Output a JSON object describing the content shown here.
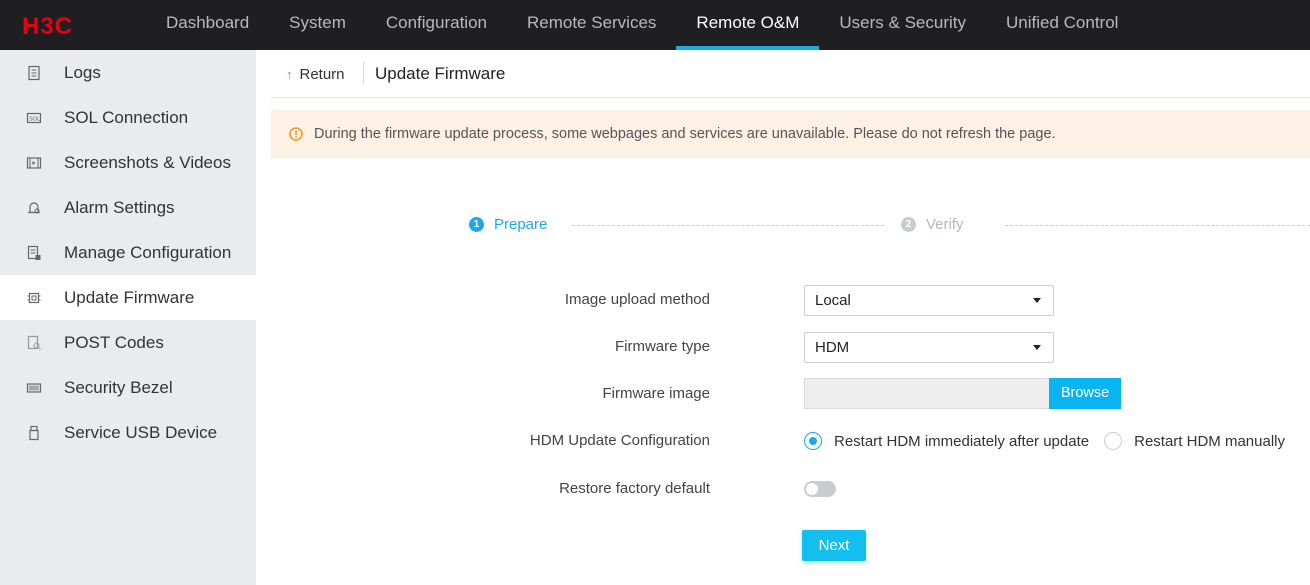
{
  "brand": {
    "logo": "H3C",
    "accent": "#1fa8e6",
    "logo_color": "#e60012"
  },
  "nav": {
    "items": [
      {
        "label": "Dashboard"
      },
      {
        "label": "System"
      },
      {
        "label": "Configuration"
      },
      {
        "label": "Remote Services"
      },
      {
        "label": "Remote O&M",
        "active": true
      },
      {
        "label": "Users & Security"
      },
      {
        "label": "Unified Control"
      }
    ]
  },
  "sidebar": {
    "items": [
      {
        "label": "Logs",
        "icon": "log-icon"
      },
      {
        "label": "SOL Connection",
        "icon": "sol-icon"
      },
      {
        "label": "Screenshots & Videos",
        "icon": "video-icon"
      },
      {
        "label": "Alarm Settings",
        "icon": "bell-icon"
      },
      {
        "label": "Manage Configuration",
        "icon": "config-icon"
      },
      {
        "label": "Update Firmware",
        "icon": "firmware-icon",
        "active": true
      },
      {
        "label": "POST Codes",
        "icon": "post-codes-icon"
      },
      {
        "label": "Security Bezel",
        "icon": "bezel-icon"
      },
      {
        "label": "Service USB Device",
        "icon": "usb-icon"
      }
    ]
  },
  "header": {
    "return_label": "Return",
    "title": "Update Firmware"
  },
  "alert": {
    "text": "During the firmware update process, some webpages and services are unavailable. Please do not refresh the page.",
    "icon": "warning-icon"
  },
  "steps": [
    {
      "num": "1",
      "label": "Prepare",
      "state": "active"
    },
    {
      "num": "2",
      "label": "Verify",
      "state": "pending"
    }
  ],
  "form": {
    "upload_method": {
      "label": "Image upload method",
      "value": "Local"
    },
    "firmware_type": {
      "label": "Firmware type",
      "value": "HDM"
    },
    "firmware_image": {
      "label": "Firmware image",
      "value": "",
      "browse_label": "Browse"
    },
    "hdm_update": {
      "label": "HDM Update Configuration",
      "options": [
        {
          "label": "Restart HDM immediately after update",
          "checked": true
        },
        {
          "label": "Restart HDM manually",
          "checked": false
        }
      ]
    },
    "restore_default": {
      "label": "Restore factory default",
      "enabled": false
    },
    "next_label": "Next"
  }
}
